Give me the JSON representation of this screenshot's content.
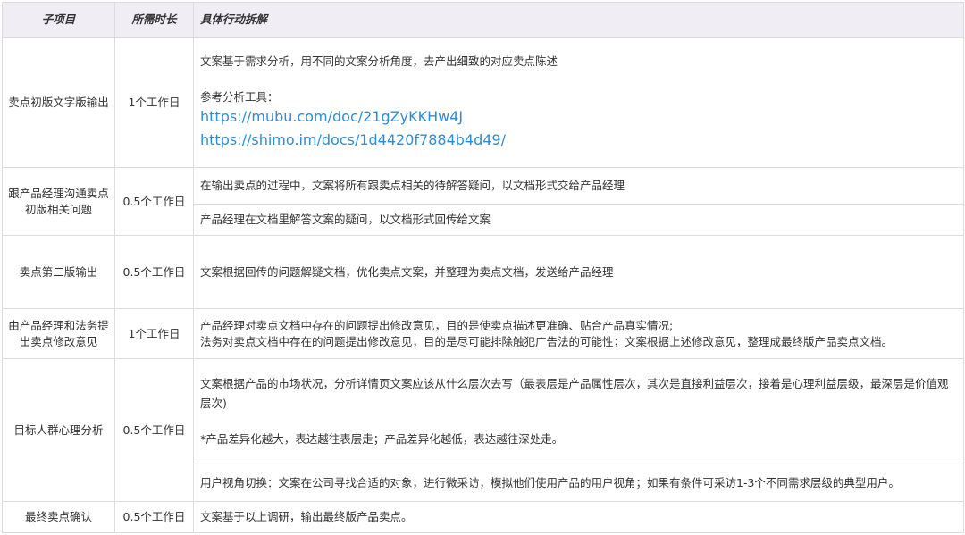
{
  "header": {
    "col_subitem": "子项目",
    "col_duration": "所需时长",
    "col_actions": "具体行动拆解"
  },
  "rows": [
    {
      "subitem": "卖点初版文字版输出",
      "duration": "1个工作日",
      "action_intro": "文案基于需求分析，用不同的文案分析角度，去产出细致的对应卖点陈述",
      "tools_label": "参考分析工具：",
      "links": [
        "https://mubu.com/doc/21gZyKKHw4J",
        "https://shimo.im/docs/1d4420f7884b4d49/"
      ]
    },
    {
      "subitem": "跟产品经理沟通卖点初版相关问题",
      "duration": "0.5个工作日",
      "actions": [
        "在输出卖点的过程中，文案将所有跟卖点相关的待解答疑问，以文档形式交给产品经理",
        "产品经理在文档里解答文案的疑问，以文档形式回传给文案"
      ]
    },
    {
      "subitem": "卖点第二版输出",
      "duration": "0.5个工作日",
      "action": "文案根据回传的问题解疑文档，优化卖点文案，并整理为卖点文档，发送给产品经理"
    },
    {
      "subitem": "由产品经理和法务提出卖点修改意见",
      "duration": "1个工作日",
      "action_line1": "产品经理对卖点文档中存在的问题提出修改意见，目的是使卖点描述更准确、贴合产品真实情况;",
      "action_line2": "法务对卖点文档中存在的问题提出修改意见，目的是尽可能排除触犯广告法的可能性；文案根据上述修改意见，整理成最终版产品卖点文档。"
    },
    {
      "subitem": "目标人群心理分析",
      "duration": "0.5个工作日",
      "action_main": "文案根据产品的市场状况，分析详情页文案应该从什么层次去写（最表层是产品属性层次，其次是直接利益层次，接着是心理利益层级，最深层是价值观层次)",
      "action_note": "*产品差异化越大，表达越往表层走；产品差异化越低，表达越往深处走。",
      "action_2": "用户视角切换：文案在公司寻找合适的对象，进行微采访，模拟他们使用产品的用户视角；如果有条件可采访1-3个不同需求层级的典型用户。"
    },
    {
      "subitem": "最终卖点确认",
      "duration": "0.5个工作日",
      "action": "文案基于以上调研，输出最终版产品卖点。"
    }
  ],
  "colors": {
    "header_bg": "#f1edf5",
    "link": "#2d8cd4",
    "border": "#dcdcdc",
    "text": "#333333"
  }
}
